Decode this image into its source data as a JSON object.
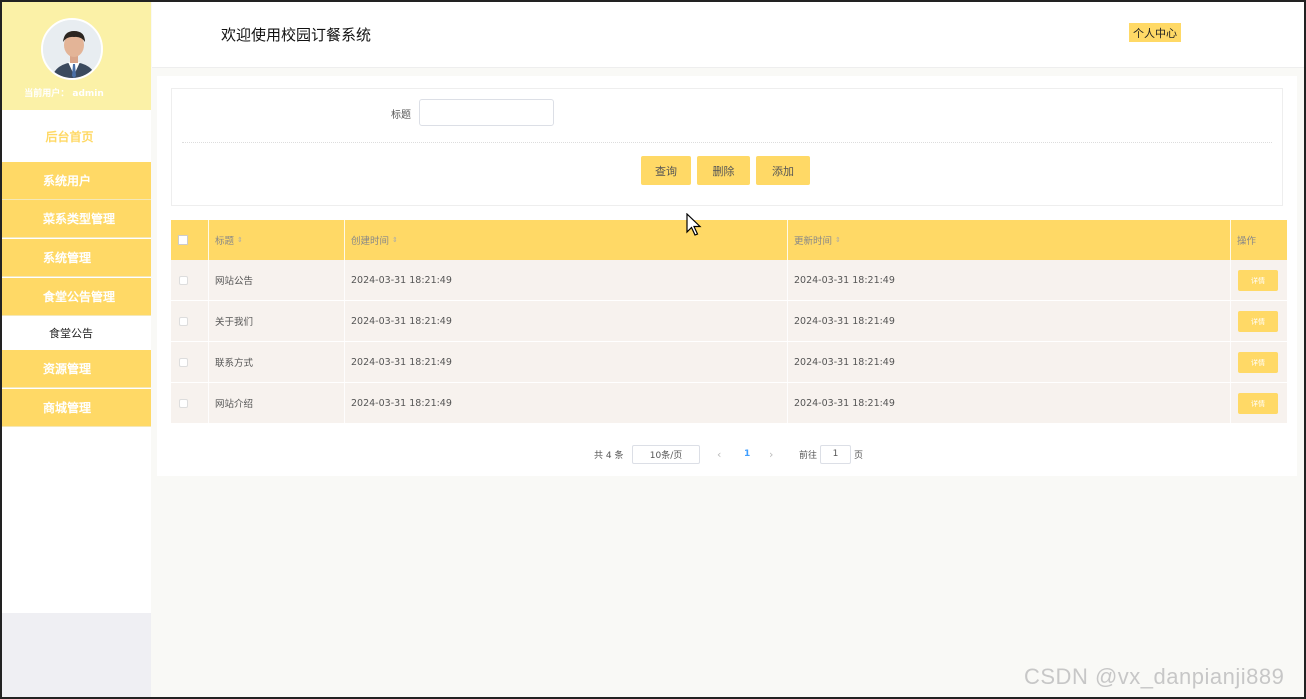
{
  "sidebar": {
    "current_user": "当前用户： admin",
    "home": "后台首页",
    "menu": [
      {
        "label": "系统用户"
      },
      {
        "label": "菜系类型管理"
      },
      {
        "label": "系统管理"
      },
      {
        "label": "食堂公告管理"
      },
      {
        "label": "资源管理"
      },
      {
        "label": "商城管理"
      }
    ],
    "submenu_active": "食堂公告"
  },
  "header": {
    "title": "欢迎使用校园订餐系统",
    "personal_center": "个人中心"
  },
  "search": {
    "label": "标题",
    "value": "",
    "placeholder": "",
    "query_btn": "查询",
    "delete_btn": "删除",
    "add_btn": "添加"
  },
  "table": {
    "columns": [
      "标题",
      "创建时间",
      "更新时间",
      "操作"
    ],
    "rows": [
      {
        "title": "网站公告",
        "created": "2024-03-31 18:21:49",
        "updated": "2024-03-31 18:21:49",
        "action": "详情"
      },
      {
        "title": "关于我们",
        "created": "2024-03-31 18:21:49",
        "updated": "2024-03-31 18:21:49",
        "action": "详情"
      },
      {
        "title": "联系方式",
        "created": "2024-03-31 18:21:49",
        "updated": "2024-03-31 18:21:49",
        "action": "详情"
      },
      {
        "title": "网站介绍",
        "created": "2024-03-31 18:21:49",
        "updated": "2024-03-31 18:21:49",
        "action": "详情"
      }
    ]
  },
  "pagination": {
    "total": "共 4 条",
    "page_size": "10条/页",
    "current_page": "1",
    "goto_prefix": "前往",
    "goto_value": "1",
    "goto_suffix": "页"
  },
  "watermark": "CSDN @vx_danpianji889",
  "colors": {
    "accent": "#ffd966",
    "sidebar_head": "#fbf1a7",
    "row_bg": "#f7f2ee",
    "page_link": "#409eff"
  }
}
